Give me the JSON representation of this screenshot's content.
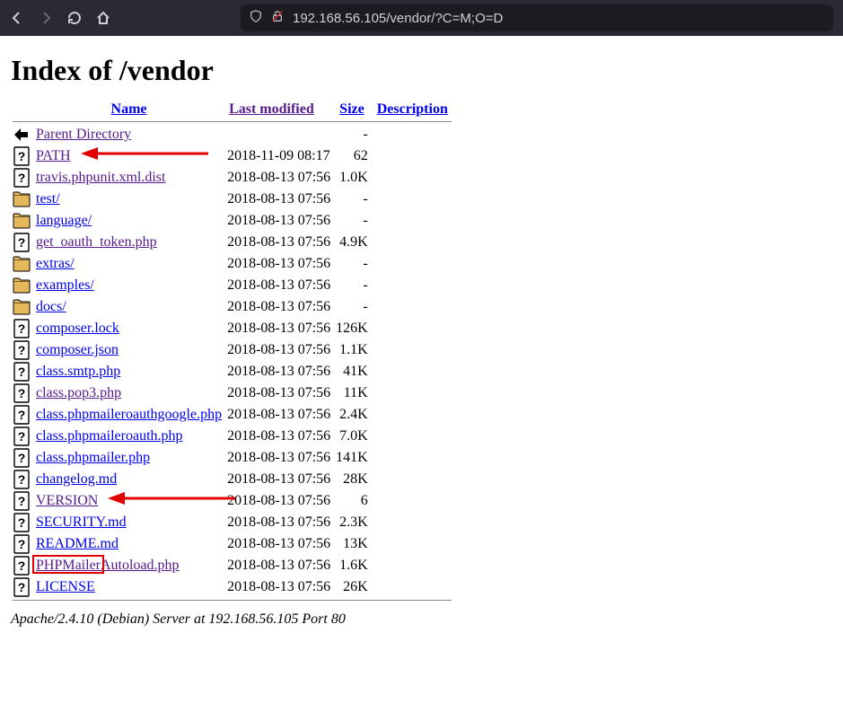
{
  "addressbar": {
    "url": "192.168.56.105/vendor/?C=M;O=D"
  },
  "page": {
    "title": "Index of /vendor",
    "footer": "Apache/2.4.10 (Debian) Server at 192.168.56.105 Port 80"
  },
  "headers": {
    "name": "Name",
    "modified": "Last modified",
    "size": "Size",
    "description": "Description"
  },
  "rows": [
    {
      "icon": "back",
      "name": "Parent Directory",
      "modified": "",
      "size": "-",
      "visited": true
    },
    {
      "icon": "file",
      "name": "PATH",
      "modified": "2018-11-09 08:17",
      "size": "62",
      "visited": true,
      "arrow": true
    },
    {
      "icon": "file",
      "name": "travis.phpunit.xml.dist",
      "modified": "2018-08-13 07:56",
      "size": "1.0K",
      "visited": true
    },
    {
      "icon": "folder",
      "name": "test/",
      "modified": "2018-08-13 07:56",
      "size": "-",
      "visited": false
    },
    {
      "icon": "folder",
      "name": "language/",
      "modified": "2018-08-13 07:56",
      "size": "-",
      "visited": false
    },
    {
      "icon": "file",
      "name": "get_oauth_token.php",
      "modified": "2018-08-13 07:56",
      "size": "4.9K",
      "visited": true
    },
    {
      "icon": "folder",
      "name": "extras/",
      "modified": "2018-08-13 07:56",
      "size": "-",
      "visited": false
    },
    {
      "icon": "folder",
      "name": "examples/",
      "modified": "2018-08-13 07:56",
      "size": "-",
      "visited": false
    },
    {
      "icon": "folder",
      "name": "docs/",
      "modified": "2018-08-13 07:56",
      "size": "-",
      "visited": false
    },
    {
      "icon": "file",
      "name": "composer.lock",
      "modified": "2018-08-13 07:56",
      "size": "126K",
      "visited": false
    },
    {
      "icon": "file",
      "name": "composer.json",
      "modified": "2018-08-13 07:56",
      "size": "1.1K",
      "visited": false
    },
    {
      "icon": "file",
      "name": "class.smtp.php",
      "modified": "2018-08-13 07:56",
      "size": "41K",
      "visited": false
    },
    {
      "icon": "file",
      "name": "class.pop3.php",
      "modified": "2018-08-13 07:56",
      "size": "11K",
      "visited": true
    },
    {
      "icon": "file",
      "name": "class.phpmaileroauthgoogle.php",
      "modified": "2018-08-13 07:56",
      "size": "2.4K",
      "visited": false
    },
    {
      "icon": "file",
      "name": "class.phpmaileroauth.php",
      "modified": "2018-08-13 07:56",
      "size": "7.0K",
      "visited": false
    },
    {
      "icon": "file",
      "name": "class.phpmailer.php",
      "modified": "2018-08-13 07:56",
      "size": "141K",
      "visited": false
    },
    {
      "icon": "file",
      "name": "changelog.md",
      "modified": "2018-08-13 07:56",
      "size": "28K",
      "visited": false
    },
    {
      "icon": "file",
      "name": "VERSION",
      "modified": "2018-08-13 07:56",
      "size": "6",
      "visited": true,
      "arrow": true
    },
    {
      "icon": "file",
      "name": "SECURITY.md",
      "modified": "2018-08-13 07:56",
      "size": "2.3K",
      "visited": false
    },
    {
      "icon": "file",
      "name": "README.md",
      "modified": "2018-08-13 07:56",
      "size": "13K",
      "visited": false
    },
    {
      "icon": "file",
      "name": "PHPMailerAutoload.php",
      "modified": "2018-08-13 07:56",
      "size": "1.6K",
      "visited": true,
      "box": true
    },
    {
      "icon": "file",
      "name": "LICENSE",
      "modified": "2018-08-13 07:56",
      "size": "26K",
      "visited": false
    }
  ]
}
